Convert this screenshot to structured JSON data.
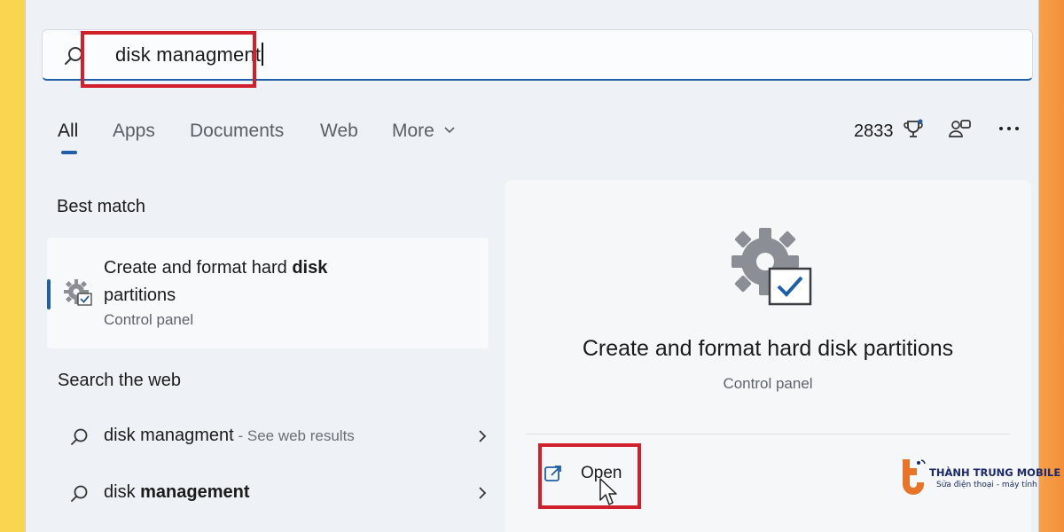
{
  "search": {
    "query": "disk managment",
    "icon": "search-icon"
  },
  "tabs": [
    {
      "label": "All",
      "active": true
    },
    {
      "label": "Apps"
    },
    {
      "label": "Documents"
    },
    {
      "label": "Web"
    },
    {
      "label": "More"
    }
  ],
  "toolbar": {
    "points": "2833",
    "trophy_icon": "trophy-icon",
    "people_icon": "people-icon",
    "more_icon": "ellipsis-icon"
  },
  "best_match": {
    "heading": "Best match",
    "title_plain": "Create and format hard ",
    "title_bold": "disk",
    "title_line2": "partitions",
    "subtitle": "Control panel"
  },
  "web_search": {
    "heading": "Search the web",
    "items": [
      {
        "text": "disk managment",
        "suffix": " - See web results"
      },
      {
        "text_plain": "disk ",
        "text_bold": "management"
      }
    ]
  },
  "detail": {
    "title": "Create and format hard disk partitions",
    "subtitle": "Control panel",
    "open_label": "Open"
  },
  "watermark": {
    "brand": "THÀNH TRUNG MOBILE",
    "tagline": "Sửa điện thoại - máy tính"
  },
  "colors": {
    "accent": "#1f5fa8",
    "highlight": "#d0202b"
  }
}
